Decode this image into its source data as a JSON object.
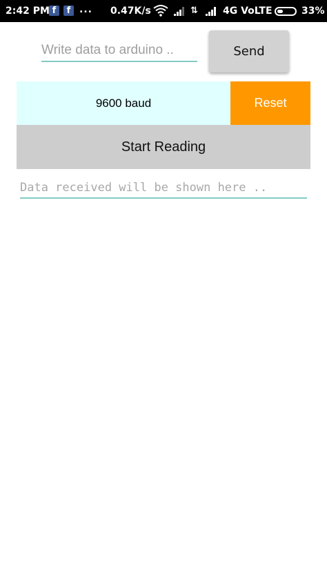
{
  "status_bar": {
    "time": "2:42 PM",
    "notification_icons": [
      "facebook-icon",
      "facebook-icon"
    ],
    "more_indicator": "...",
    "net_speed": "0.47K/s",
    "network": "4G VoLTE",
    "battery_percent": "33%",
    "battery_level": 0.33
  },
  "controls": {
    "write_placeholder": "Write data to arduino ..",
    "send_label": "Send",
    "baud_value": "9600 baud",
    "reset_label": "Reset",
    "start_label": "Start Reading",
    "received_placeholder": "Data received will be shown here .."
  },
  "colors": {
    "reset_bg": "#ff9800",
    "baud_bg": "#e0ffff",
    "button_gray": "#cdcdcd",
    "underline": "#80cbc4"
  }
}
